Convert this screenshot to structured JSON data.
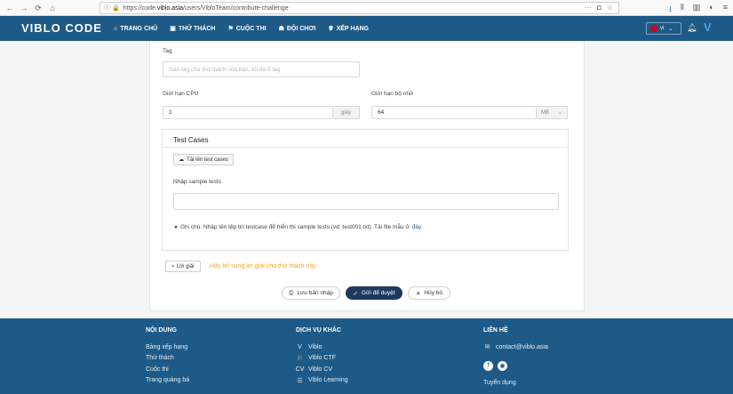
{
  "browser": {
    "url_prefix": "https://code.",
    "url_domain": "viblo.asia",
    "url_path": "/users/VibloTeam/contribute-challenge",
    "menu_icon": "ellipsis-icon"
  },
  "navbar": {
    "logo": "VIBLO CODE",
    "items": [
      {
        "label": "TRANG CHỦ",
        "icon": "home-icon"
      },
      {
        "label": "THỬ THÁCH",
        "icon": "code-icon"
      },
      {
        "label": "CUỘC THI",
        "icon": "trophy-icon"
      },
      {
        "label": "ĐỘI CHƠI",
        "icon": "team-icon"
      },
      {
        "label": "XẾP HẠNG",
        "icon": "ranking-icon"
      }
    ],
    "lang": "vi"
  },
  "form": {
    "tag_label": "Tag",
    "tag_placeholder": "Gán tag cho thử thách của bạn, tối đa 5 tag",
    "cpu_label": "Giới hạn CPU",
    "cpu_value": "1",
    "cpu_unit": "giây",
    "memory_label": "Giới hạn bộ nhớ",
    "memory_value": "64",
    "memory_unit": "MB",
    "testcases_title": "Test Cases",
    "upload_label": "Tải lên test cases",
    "sample_label": "Nhập sample tests",
    "sample_value": "",
    "note_text": "Ghi chú: Nhập tên tệp tin testcase để hiển thị sample tests (vd: test001.txt). Tải file mẫu ở",
    "note_link": "đây",
    "solution_button": "Lời giải",
    "solution_hint": "Hãy bổ sung lời giải cho thử thách này",
    "save_draft": "Lưu bản nháp",
    "submit": "Gửi để duyệt",
    "cancel": "Hủy bỏ"
  },
  "footer": {
    "content_heading": "NỘI DUNG",
    "content_links": [
      "Bảng xếp hạng",
      "Thử thách",
      "Cuộc thi",
      "Trang quảng bá"
    ],
    "services_heading": "DỊCH VỤ KHÁC",
    "services": [
      {
        "label": "Viblo",
        "icon": "viblo-icon"
      },
      {
        "label": "Viblo CTF",
        "icon": "ctf-icon"
      },
      {
        "label": "Viblo CV",
        "icon": "cv-icon"
      },
      {
        "label": "Viblo Learning",
        "icon": "learning-icon"
      }
    ],
    "contact_heading": "LIÊN HỆ",
    "contact_email": "contact@viblo.asia",
    "careers": "Tuyển dụng"
  }
}
